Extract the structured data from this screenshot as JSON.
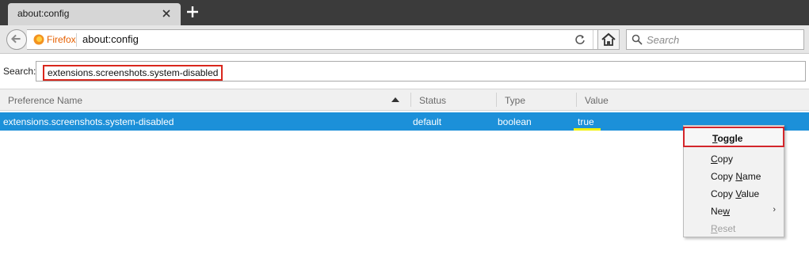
{
  "tab": {
    "title": "about:config"
  },
  "navbar": {
    "identity_label": "Firefox",
    "url": "about:config",
    "search_placeholder": "Search"
  },
  "filter": {
    "label": "Search:",
    "value": "extensions.screenshots.system-disabled"
  },
  "columns": [
    "Preference Name",
    "Status",
    "Type",
    "Value"
  ],
  "rows": [
    {
      "name": "extensions.screenshots.system-disabled",
      "status": "default",
      "type": "boolean",
      "value": "true",
      "selected": true
    }
  ],
  "context_menu": {
    "items": [
      {
        "label": "Toggle",
        "accesskey": "T",
        "highlighted": true,
        "disabled": false
      },
      {
        "label": "Copy",
        "accesskey": "C",
        "disabled": false
      },
      {
        "label": "Copy Name",
        "accesskey": "N",
        "disabled": false
      },
      {
        "label": "Copy Value",
        "accesskey": "V",
        "disabled": false
      },
      {
        "label": "New",
        "accesskey": "w",
        "has_submenu": true,
        "disabled": false
      },
      {
        "label": "Reset",
        "accesskey": "R",
        "disabled": true
      }
    ]
  },
  "colors": {
    "selection": "#1c90d9",
    "highlight_border": "#d9261c",
    "value_underline": "#f1f10a"
  }
}
